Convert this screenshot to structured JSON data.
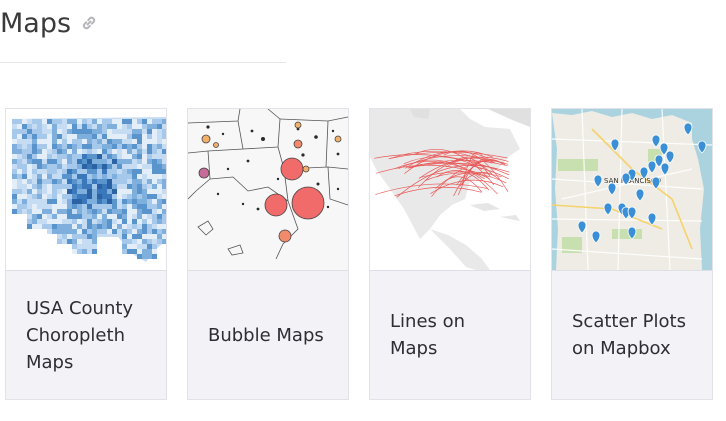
{
  "section": {
    "title": "Maps",
    "link_icon": "link-icon"
  },
  "cards": [
    {
      "label": "USA County Choropleth Maps",
      "thumbnail": "choropleth-map-thumbnail"
    },
    {
      "label": "Bubble Maps",
      "thumbnail": "bubble-map-thumbnail"
    },
    {
      "label": "Lines on Maps",
      "thumbnail": "lines-map-thumbnail"
    },
    {
      "label": "Scatter Plots on Mapbox",
      "thumbnail": "mapbox-scatter-thumbnail"
    }
  ],
  "mapbox_thumb_text": {
    "city": "SAN FRANCISCO"
  },
  "colors": {
    "card_bg": "#f3f3f7",
    "text": "#2d2d33",
    "bubble": "#f26b6b",
    "lines": "#e8403f",
    "choropleth_dark": "#2b6cb0",
    "marker": "#3a8fd6"
  }
}
